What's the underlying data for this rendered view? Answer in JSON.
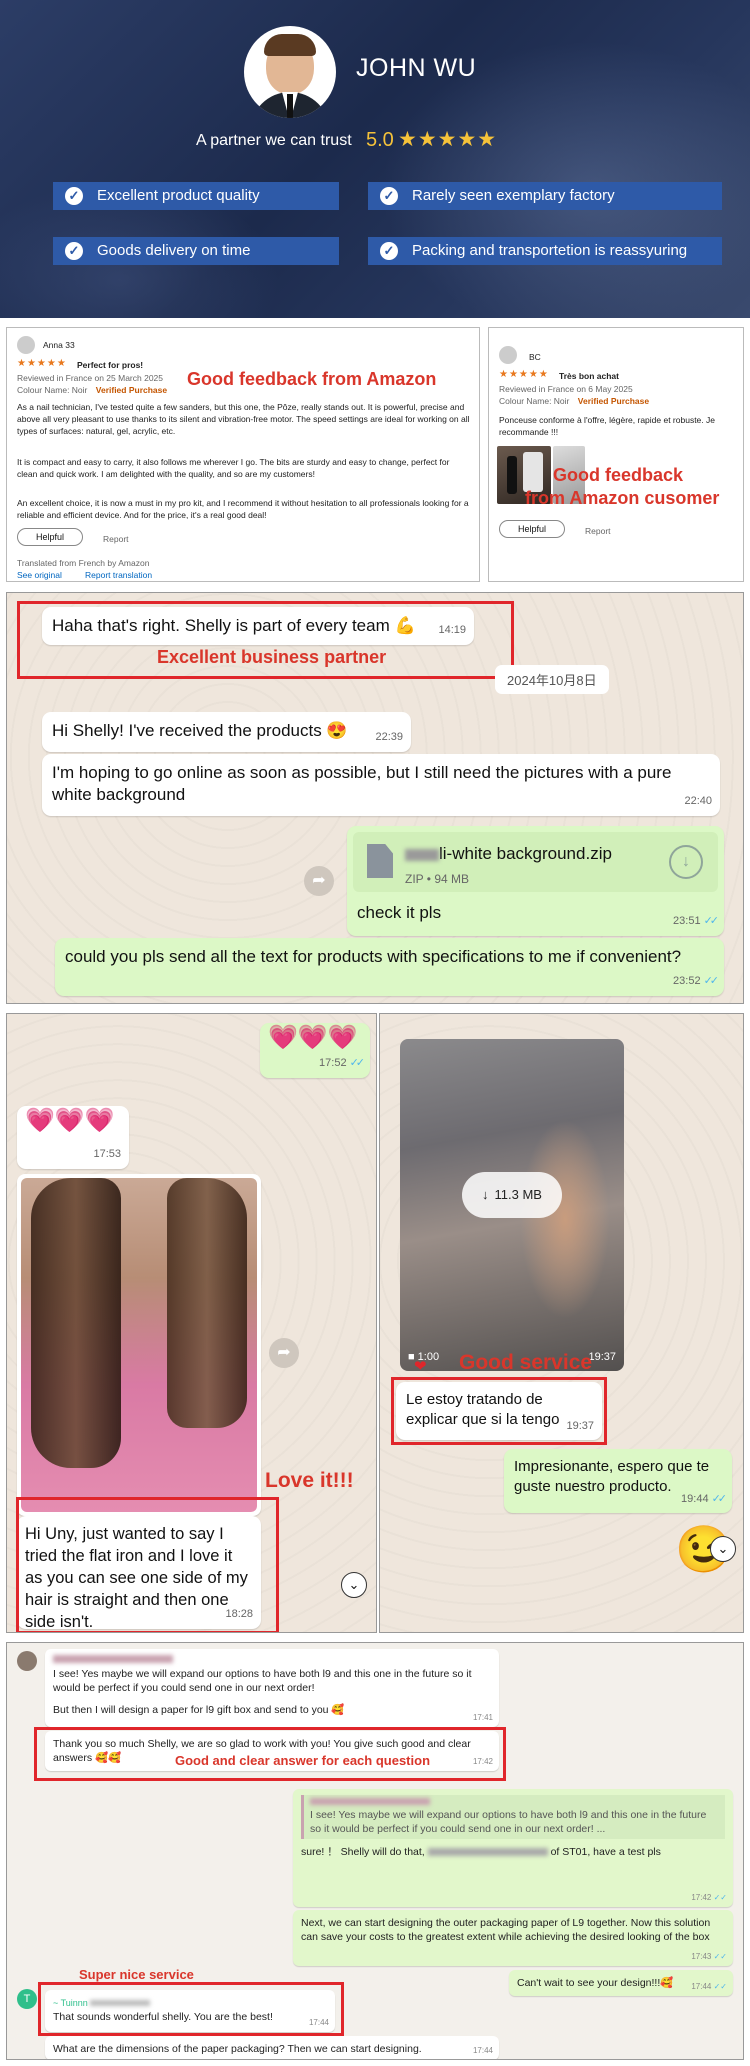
{
  "header": {
    "name": "JOHN WU",
    "tagline": "A partner we can trust",
    "rating": "5.0",
    "stars": "★★★★★",
    "badges": [
      "Excellent product quality",
      "Rarely seen exemplary factory",
      "Goods delivery on time",
      "Packing and transportetion is reassyuring"
    ]
  },
  "reviews": [
    {
      "user": "Anna 33",
      "stars": "★★★★★",
      "title": "Perfect for pros!",
      "meta": "Reviewed in France on 25 March 2025",
      "colour": "Colour Name: Noir",
      "verified": "Verified Purchase",
      "p1": "As a nail technician, I've tested quite a few sanders, but this one, the Pôze, really stands out. It is powerful, precise and above all very pleasant to use thanks to its silent and vibration-free motor. The speed settings are ideal for working on all types of surfaces: natural, gel, acrylic, etc.",
      "p2": "It is compact and easy to carry, it also follows me wherever I go. The bits are sturdy and easy to change, perfect for clean and quick work. I am delighted with the quality, and so are my customers!",
      "p3": "An excellent choice, it is now a must in my pro kit, and I recommend it without hesitation to all professionals looking for a reliable and efficient device. And for the price, it's a real good deal!",
      "helpful": "Helpful",
      "report": "Report",
      "translated": "Translated from French by Amazon",
      "see_original": "See original",
      "report_translation": "Report translation",
      "annotation": "Good feedback from Amazon"
    },
    {
      "user": "BC",
      "stars": "★★★★★",
      "title": "Très bon achat",
      "meta": "Reviewed in France on 6 May 2025",
      "colour": "Colour Name: Noir",
      "verified": "Verified Purchase",
      "p1": "Ponceuse conforme à l'offre, légère, rapide et robuste. Je recommande !!!",
      "helpful": "Helpful",
      "report": "Report",
      "annotation1": "Good feedback",
      "annotation2": "from Amazon cusomer"
    }
  ],
  "chat1": {
    "m1": "Haha that's right. Shelly is part of every team 💪",
    "m1_time": "14:19",
    "annotation": "Excellent business partner",
    "date": "2024年10月8日",
    "m2": "Hi Shelly! I've received the products 😍",
    "m2_time": "22:39",
    "m3": "I'm hoping to go online as soon as possible, but I still need the pictures with a pure white background",
    "m3_time": "22:40",
    "file_name": "li-white background.zip",
    "file_meta": "ZIP • 94 MB",
    "m4": "check it pls",
    "m4_time": "23:51",
    "m5": "could you pls send all the text for products with specifications to me if convenient?",
    "m5_time": "23:52"
  },
  "chat2": {
    "hearts": "💗💗💗",
    "h1_time": "17:52",
    "h2_time": "17:53",
    "annotation": "Love it!!!",
    "m1": "Hi Uny, just wanted to say I tried the flat iron and I love it as you can see one side of my hair is straight and then one side isn't.",
    "m1_time": "18:28"
  },
  "chat3": {
    "video_size": "11.3 MB",
    "video_len": "1:00",
    "video_time": "19:37",
    "annotation": "Good service",
    "m1": "Le estoy tratando de explicar que si la tengo",
    "m1_time": "19:37",
    "m2": "Impresionante, espero que te guste nuestro producto.",
    "m2_time": "19:44",
    "emoji": "😉"
  },
  "chat4": {
    "m1a": "I see! Yes maybe we will expand our options to have both l9 and this one in the future so it would be perfect if you could send one in our next order!",
    "m1b": "But then I will design a paper for l9 gift box and send to you 🥰",
    "m1_time": "17:41",
    "m2": "Thank you so much Shelly, we are so glad to work with you! You give such good and clear answers 🥰🥰",
    "m2_time": "17:42",
    "annotation1": "Good and clear answer for each question",
    "quote": "I see! Yes maybe we will expand our options to have both l9 and this one in the future so it would be perfect if you could send one in our next order! ...",
    "m3a": "sure! ！ Shelly will do that,",
    "m3b": "of ST01, have a test pls",
    "m3_time": "17:42",
    "m4": "Next, we can start designing the outer packaging paper of L9 together. Now this solution can save your costs to the greatest extent while achieving the desired looking of the box",
    "m4_time": "17:43",
    "m5": "Can't wait to see your design!!!🥰",
    "m5_time": "17:44",
    "annotation2": "Super nice service",
    "avatar_letter": "T",
    "m6_name": "~ Tuinnn",
    "m6": "That sounds wonderful shelly. You are the best!",
    "m6_time": "17:44",
    "m7": "What are the dimensions of the paper packaging? Then we can start designing.",
    "m7_time": "17:44"
  },
  "colors": {
    "banner": "#1f2f55",
    "badge": "#2e5aa8",
    "annotation": "#d9362b",
    "star": "#e8781e",
    "gold": "#f5c23a"
  }
}
